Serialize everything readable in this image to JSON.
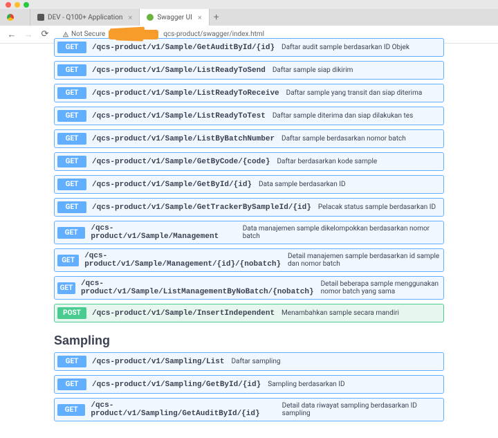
{
  "titlebar": {},
  "tabs": [
    {
      "label": ""
    },
    {
      "label": "DEV - Q100+ Application"
    },
    {
      "label": "Swagger UI"
    }
  ],
  "urlbar": {
    "not_secure": "Not Secure",
    "url_suffix": "qcs-product/swagger/index.html"
  },
  "endpoints_top": [
    {
      "method": "GET",
      "path": "/qcs-product/v1/Sample/GetAuditById/{id}",
      "desc": "Daftar audit sample berdasarkan ID Objek"
    },
    {
      "method": "GET",
      "path": "/qcs-product/v1/Sample/ListReadyToSend",
      "desc": "Daftar sample siap dikirim"
    },
    {
      "method": "GET",
      "path": "/qcs-product/v1/Sample/ListReadyToReceive",
      "desc": "Daftar sample yang transit dan siap diterima"
    },
    {
      "method": "GET",
      "path": "/qcs-product/v1/Sample/ListReadyToTest",
      "desc": "Daftar sample diterima dan siap dilakukan tes"
    },
    {
      "method": "GET",
      "path": "/qcs-product/v1/Sample/ListByBatchNumber",
      "desc": "Daftar sample berdasarkan nomor batch"
    },
    {
      "method": "GET",
      "path": "/qcs-product/v1/Sample/GetByCode/{code}",
      "desc": "Daftar berdasarkan kode sample"
    },
    {
      "method": "GET",
      "path": "/qcs-product/v1/Sample/GetById/{id}",
      "desc": "Data sample berdasarkan ID"
    },
    {
      "method": "GET",
      "path": "/qcs-product/v1/Sample/GetTrackerBySampleId/{id}",
      "desc": "Pelacak status sample berdasarkan ID"
    },
    {
      "method": "GET",
      "path": "/qcs-product/v1/Sample/Management",
      "desc": "Data manajemen sample dikelompokkan berdasarkan nomor batch"
    },
    {
      "method": "GET",
      "path": "/qcs-product/v1/Sample/Management/{id}/{nobatch}",
      "desc": "Detail manajemen sample berdasarkan id sample dan nomor batch"
    },
    {
      "method": "GET",
      "path": "/qcs-product/v1/Sample/ListManagementByNoBatch/{nobatch}",
      "desc": "Detail beberapa sample menggunakan nomor batch yang sama"
    },
    {
      "method": "POST",
      "path": "/qcs-product/v1/Sample/InsertIndependent",
      "desc": "Menambahkan sample secara mandiri"
    }
  ],
  "section2_title": "Sampling",
  "endpoints_sampling": [
    {
      "method": "GET",
      "path": "/qcs-product/v1/Sampling/List",
      "desc": "Daftar sampling"
    },
    {
      "method": "GET",
      "path": "/qcs-product/v1/Sampling/GetById/{id}",
      "desc": "Sampling berdasarkan ID"
    },
    {
      "method": "GET",
      "path": "/qcs-product/v1/Sampling/GetAuditById/{id}",
      "desc": "Detail data riwayat sampling berdasarkan ID sampling"
    }
  ]
}
